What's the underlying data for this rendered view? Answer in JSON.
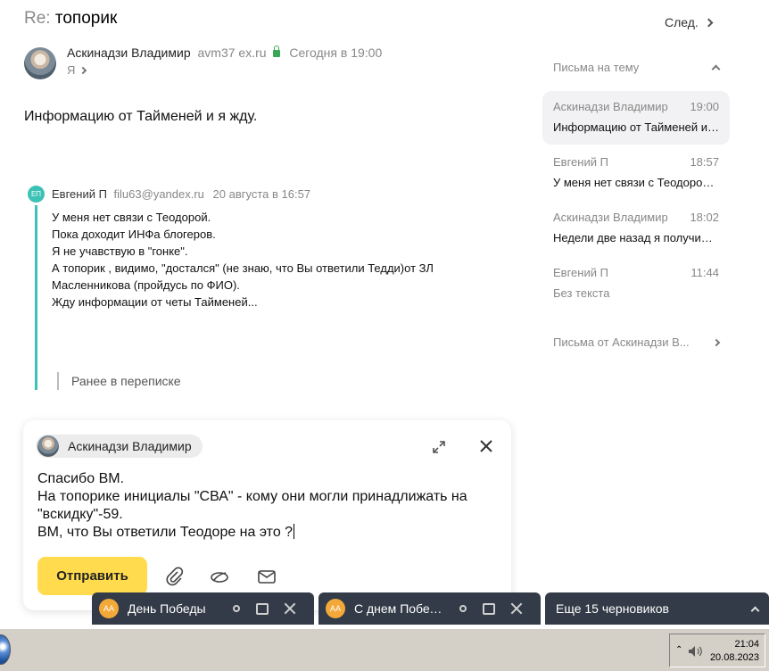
{
  "message": {
    "subject_prefix": "Re:",
    "subject": "топорик",
    "next_label": "След.",
    "sender_name": "Аскинадзи Владимир",
    "sender_email": "avm37              ex.ru",
    "date": "Сегодня в 19:00",
    "recipient": "Я",
    "body": "Информацию от  Тайменей и я жду."
  },
  "quote": {
    "avatar_initials": "ЕП",
    "author": "Евгений П",
    "email": "filu63@yandex.ru",
    "date": "20 августа в 16:57",
    "lines": [
      "У меня нет  связи с Теодорой.",
      "Пока доходит ИНФа  блогеров.",
      "Я не учавствую в \"гонке\".",
      "А топорик , видимо, \"достался\" (не знаю, что Вы ответили Тедди)от ЗЛ",
      "Масленникова (пройдусь по ФИО).",
      "Жду информации от четы Тайменей..."
    ],
    "earlier_label": "Ранее в переписке"
  },
  "thread": {
    "header": "Письма на тему",
    "items": [
      {
        "author": "Аскинадзи Владимир",
        "time": "19:00",
        "preview": "Информацию от Тайменей и я жду."
      },
      {
        "author": "Евгений П",
        "time": "18:57",
        "preview": "У меня нет связи с Теодорой. Пока"
      },
      {
        "author": "Аскинадзи Владимир",
        "time": "18:02",
        "preview": "Недели две назад я получил топорик"
      },
      {
        "author": "Евгений П",
        "time": "11:44",
        "preview": "Без текста"
      }
    ],
    "letters_from": "Письма от Аскинадзи В..."
  },
  "compose": {
    "from_name": "Аскинадзи Владимир",
    "lines": [
      "Спасибо ВМ.",
      "На топорике инициалы \"СВА\" - кому они могли принадлижать на",
      "\"вскидку\"-59.",
      "ВМ, что Вы ответили Теодоре на это ?"
    ],
    "send_label": "Отправить"
  },
  "drafts": [
    {
      "initials": "АА",
      "label": "День Победы"
    },
    {
      "initials": "АА",
      "label": "С днем Победы"
    }
  ],
  "more_drafts": "Еще 15 черновиков",
  "taskbar": {
    "time": "21:04",
    "date": "20.08.2023"
  },
  "colors": {
    "accent_teal": "#3cc1b5",
    "send_yellow": "#ffdb4d",
    "drafts_bg": "#323b47",
    "secure_green": "#3aa757"
  }
}
